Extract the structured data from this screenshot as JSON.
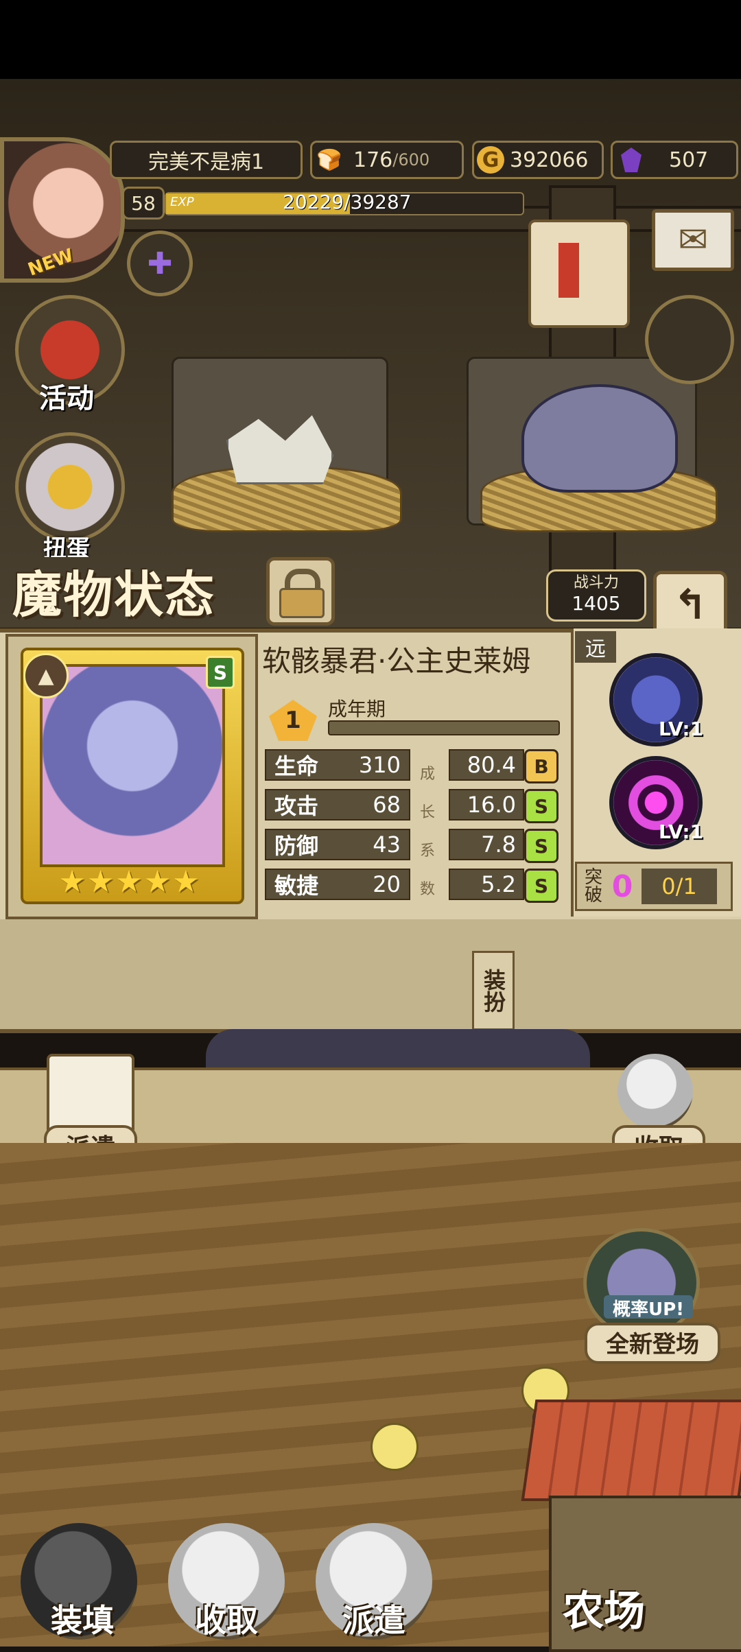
{
  "hud": {
    "player_name": "完美不是病1",
    "stamina_current": "176",
    "stamina_max": "/600",
    "gold": "392066",
    "gems": "507",
    "level": "58",
    "exp_label": "EXP",
    "exp_value": "20229/39287",
    "exp_fraction": 0.515,
    "new_badge": "NEW"
  },
  "side_buttons": {
    "activity": "活动",
    "gacha": "扭蛋"
  },
  "status": {
    "title": "魔物状态",
    "power_label": "战斗力",
    "power_value": "1405",
    "back_icon": "back-arrow-icon"
  },
  "monster": {
    "name": "软骸暴君·公主史莱姆",
    "rarity": "S",
    "stars": "★★★★★",
    "stage_number": "1",
    "stage_name": "成年期",
    "growth_caption": [
      "成",
      "长",
      "系",
      "数"
    ],
    "stats": [
      {
        "label": "生命",
        "value": "310",
        "growth": "80.4",
        "grade": "B",
        "grade_color": "#f1c453"
      },
      {
        "label": "攻击",
        "value": "68",
        "growth": "16.0",
        "grade": "S",
        "grade_color": "#a9e043"
      },
      {
        "label": "防御",
        "value": "43",
        "growth": "7.8",
        "grade": "S",
        "grade_color": "#a9e043"
      },
      {
        "label": "敏捷",
        "value": "20",
        "growth": "5.2",
        "grade": "S",
        "grade_color": "#a9e043"
      }
    ],
    "range": "远",
    "skills": [
      {
        "level": "LV:1",
        "icon": "tentacle-skill-icon"
      },
      {
        "level": "LV:1",
        "icon": "spiral-skill-icon"
      }
    ],
    "breakthrough_label": "突破",
    "breakthrough_count": "0",
    "breakthrough_progress": "0/1"
  },
  "farm": {
    "dress_tab": "装扮",
    "dispatch_left": "派遣",
    "collect_right": "收取",
    "promo_line1": "概率UP!",
    "promo_line2": "全新登场",
    "bottom_buttons": [
      "装填",
      "收取",
      "派遣"
    ],
    "farm_label": "农场"
  }
}
